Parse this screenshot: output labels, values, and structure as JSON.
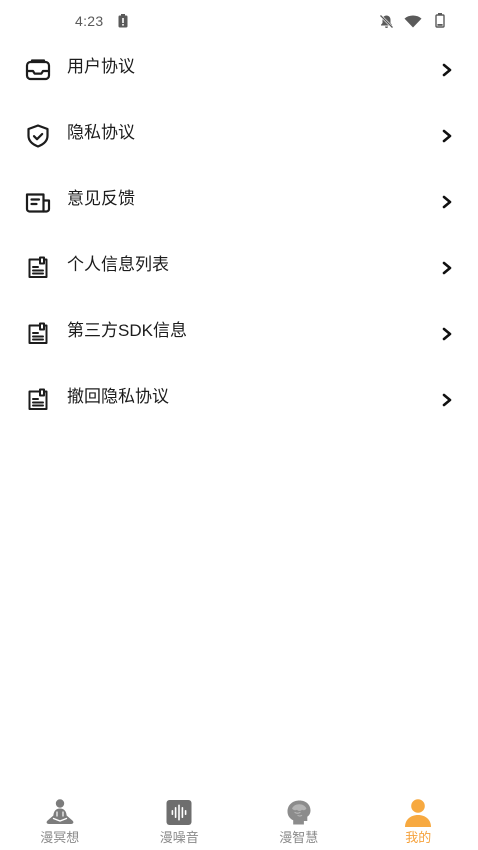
{
  "status_bar": {
    "time": "4:23",
    "left_icons": [
      "battery-alert-icon"
    ],
    "right_icons": [
      "notifications-off-icon",
      "wifi-icon",
      "battery-icon"
    ]
  },
  "menu": {
    "items": [
      {
        "label": "用户协议",
        "icon": "inbox-icon"
      },
      {
        "label": "隐私协议",
        "icon": "shield-check-icon"
      },
      {
        "label": "意见反馈",
        "icon": "newspaper-icon"
      },
      {
        "label": "个人信息列表",
        "icon": "document-icon"
      },
      {
        "label": "第三方SDK信息",
        "icon": "document-icon"
      },
      {
        "label": "撤回隐私协议",
        "icon": "document-icon"
      }
    ],
    "trailing_icon": "chevron-right-icon"
  },
  "tab_bar": {
    "tabs": [
      {
        "label": "漫冥想",
        "icon": "meditation-icon",
        "active": false
      },
      {
        "label": "漫噪音",
        "icon": "sound-wave-icon",
        "active": false
      },
      {
        "label": "漫智慧",
        "icon": "brain-head-icon",
        "active": false
      },
      {
        "label": "我的",
        "icon": "profile-icon",
        "active": true
      }
    ]
  },
  "colors": {
    "background": "#FFFFFF",
    "text": "#1C1C1C",
    "status_text": "#5A5A5A",
    "tab_inactive": "#8A8A8A",
    "tab_active": "#F5A23D"
  }
}
